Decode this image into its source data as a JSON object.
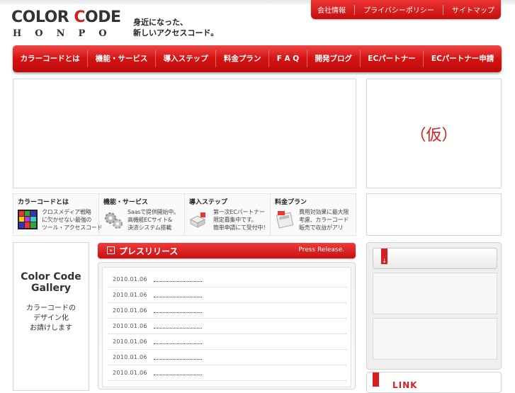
{
  "brand": {
    "logo_left": "COLOR ",
    "logo_accent": "C",
    "logo_right": "ODE",
    "logo_sub": "HONPO",
    "tagline_line1": "身近になった、",
    "tagline_line2": "新しいアクセスコード。"
  },
  "util_nav": [
    "会社情報",
    "プライバシーポリシー",
    "サイトマップ"
  ],
  "main_nav": [
    "カラーコードとは",
    "機能・サービス",
    "導入ステップ",
    "料金プラン",
    "F A Q",
    "開発ブログ",
    "ECパートナー",
    "ECパートナー申請"
  ],
  "side_box_text": "（仮）",
  "features": [
    {
      "title": "カラーコードとは",
      "text": "クロスメディア戦略\nに欠かせない最強の\nツール・アクセスコード",
      "icon": "color-grid-icon"
    },
    {
      "title": "機能・サービス",
      "text": "Saasで提供開始中。\n高機能ECサイト&\n決済システム搭載",
      "icon": "gear-icon"
    },
    {
      "title": "導入ステップ",
      "text": "第一次ECパートナー\n限定募集中です。\n簡単申請にて受付中！",
      "icon": "blocks-icon"
    },
    {
      "title": "料金プラン",
      "text": "費用対効果に最大限\n考慮、カラーコード\n販売で収益がアリ",
      "icon": "calculator-icon"
    }
  ],
  "gallery": {
    "title_line1": "Color Code",
    "title_line2": "Gallery",
    "text_line1": "カラーコードの",
    "text_line2": "デザイン化",
    "text_line3": "お請けします"
  },
  "press": {
    "title": "プレスリリース",
    "subtitle": "Press Release.",
    "items": [
      "2010.01.06",
      "2010.01.06",
      "2010.01.06",
      "2010.01.06",
      "2010.01.06",
      "2010.01.06",
      "2010.01.06"
    ]
  },
  "right": {
    "arrow": "↓",
    "link_label": "LINK"
  },
  "colors": {
    "accent": "#d81e1e",
    "nav_top": "#f04646",
    "nav_bottom": "#bd0b0b"
  }
}
